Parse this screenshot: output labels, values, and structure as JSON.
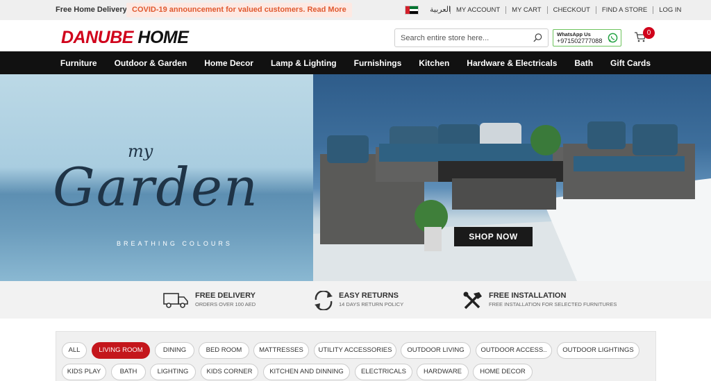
{
  "topbar": {
    "free_delivery": "Free Home Delivery",
    "announcement": "COVID-19 announcement for valued customers. Read More",
    "language": "العربية",
    "links": [
      "MY ACCOUNT",
      "MY CART",
      "CHECKOUT",
      "FIND A STORE",
      "LOG IN"
    ]
  },
  "header": {
    "logo_part1": "DANUBE",
    "logo_part2": "HOME",
    "search_placeholder": "Search entire store here...",
    "whatsapp_label": "WhatsApp Us",
    "whatsapp_number": "+971502777088",
    "cart_count": "0"
  },
  "nav": [
    "Furniture",
    "Outdoor & Garden",
    "Home Decor",
    "Lamp & Lighting",
    "Furnishings",
    "Kitchen",
    "Hardware & Electricals",
    "Bath",
    "Gift Cards"
  ],
  "hero": {
    "script_small": "my",
    "script_large": "Garden",
    "tagline": "BREATHING COLOURS",
    "cta": "SHOP NOW"
  },
  "features": [
    {
      "title": "FREE DELIVERY",
      "subtitle": "ORDERS OVER 100 AED",
      "icon": "truck-icon"
    },
    {
      "title": "EASY RETURNS",
      "subtitle": "14 DAYS RETURN POLICY",
      "icon": "returns-icon"
    },
    {
      "title": "FREE INSTALLATION",
      "subtitle": "FREE INSTALLATION FOR SELECTED FURNITURES",
      "icon": "tools-icon"
    }
  ],
  "categories": {
    "active": "LIVING ROOM",
    "row1": [
      "ALL",
      "LIVING ROOM",
      "DINING",
      "BED ROOM",
      "MATTRESSES",
      "UTILITY ACCESSORIES",
      "OUTDOOR LIVING",
      "OUTDOOR ACCESS..",
      "OUTDOOR LIGHTINGS"
    ],
    "row2": [
      "KIDS PLAY",
      "BATH",
      "LIGHTING",
      "KIDS CORNER",
      "KITCHEN AND DINNING",
      "ELECTRICALS",
      "HARDWARE",
      "HOME DECOR"
    ]
  },
  "colors": {
    "brand_red": "#d0021b",
    "nav_bg": "#111111",
    "announcement_text": "#e0592f",
    "whatsapp_green": "#6cc35c"
  }
}
